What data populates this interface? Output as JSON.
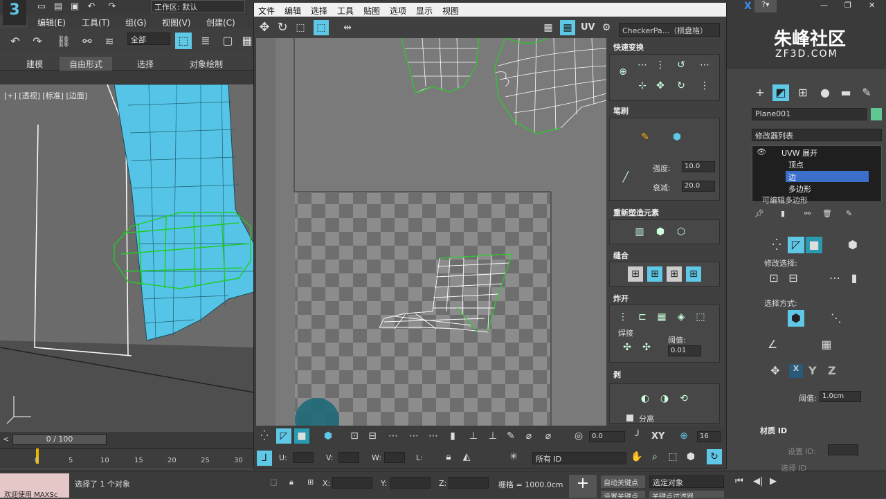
{
  "app": {
    "logo_text": "3",
    "workspace_label": "工作区: 默认",
    "window_buttons": [
      "—",
      "❐",
      "✕"
    ]
  },
  "menu": {
    "items": [
      "编辑(E)",
      "工具(T)",
      "组(G)",
      "视图(V)",
      "创建(C)"
    ]
  },
  "toolbar": {
    "selection_filter": "全部"
  },
  "ribbon": {
    "tabs": [
      "建模",
      "自由形式",
      "选择",
      "对象绘制"
    ]
  },
  "viewport": {
    "label": "[+] [透视] [标准] [边面]"
  },
  "timeline": {
    "frame_display": "0 / 100",
    "ticks": [
      "0",
      "5",
      "10",
      "15",
      "20",
      "25",
      "30"
    ]
  },
  "status": {
    "welcome": "欢迎使用 MAXSc",
    "selection_text": "选择了 1 个对象",
    "x_label": "X:",
    "y_label": "Y:",
    "z_label": "Z:",
    "grid_text": "栅格 = 1000.0cm",
    "auto_key": "自动关键点",
    "set_key_dropdown": "选定对象",
    "set_key": "设置关键点",
    "key_filters": "关键点过滤器..."
  },
  "uv_editor": {
    "menu": [
      "文件",
      "编辑",
      "选择",
      "工具",
      "贴图",
      "选项",
      "显示",
      "视图"
    ],
    "uv_label": "UV",
    "checker_select": "CheckerPa...（棋盘格）",
    "rollouts": {
      "quick_transform": "快速变换",
      "brush": "笔刷",
      "strength_label": "强度:",
      "strength_value": "10.0",
      "falloff_label": "衰减:",
      "falloff_value": "20.0",
      "reshape": "重新塑造元素",
      "stitch": "缝合",
      "explode": "炸开",
      "weld": "焊接",
      "threshold_label": "阈值:",
      "threshold_value": "0.01",
      "peel": "剥",
      "detach": "分离"
    },
    "bottom": {
      "angle_value": "0.0",
      "xy_label": "XY",
      "grid_value": "16",
      "u_label": "U:",
      "v_label": "V:",
      "w_label": "W:",
      "l_label": "L:",
      "all_ids": "所有 ID"
    }
  },
  "command_panel": {
    "object_name": "Plane001",
    "modifier_list": "修改器列表",
    "stack": [
      "UVW 展开",
      "顶点",
      "边",
      "多边形",
      "可编辑多边形"
    ],
    "selected_stack_index": 2,
    "modify_selection": "修改选择:",
    "selection_method": "选择方式:",
    "threshold_label": "阈值:",
    "threshold_value": "1.0cm",
    "xyz": [
      "X",
      "Y",
      "Z"
    ],
    "material_id": "材质 ID",
    "set_id": "设置 ID:",
    "select_id": "选择 ID"
  },
  "watermark": {
    "title": "朱峰社区",
    "subtitle": "ZF3D.COM"
  },
  "colors": {
    "accent": "#5ec8e6",
    "uv_green": "#33cc33",
    "selected": "#3b6fc9"
  }
}
